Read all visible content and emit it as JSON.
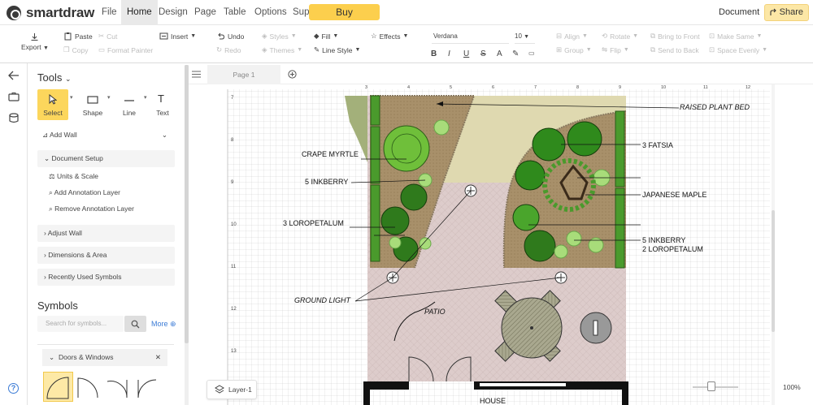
{
  "app": {
    "brand": "smartdraw",
    "document_label": "Document",
    "share_label": "Share",
    "buy_label": "Buy"
  },
  "menu": [
    "File",
    "Home",
    "Design",
    "Page",
    "Table",
    "Options",
    "Support"
  ],
  "menu_active": "Home",
  "ribbon": {
    "export": "Export",
    "paste": "Paste",
    "cut": "Cut",
    "copy": "Copy",
    "format_painter": "Format Painter",
    "insert": "Insert",
    "undo": "Undo",
    "redo": "Redo",
    "styles": "Styles",
    "themes": "Themes",
    "fill": "Fill",
    "line_style": "Line Style",
    "effects": "Effects",
    "font": "Verdana",
    "font_size": "10",
    "bold": "B",
    "italic": "I",
    "underline": "U",
    "strike": "S",
    "align": "Align",
    "group": "Group",
    "rotate": "Rotate",
    "flip": "Flip",
    "bring_to_front": "Bring to Front",
    "send_to_back": "Send to Back",
    "make_same": "Make Same",
    "space_evenly": "Space Evenly"
  },
  "panel": {
    "tools_title": "Tools",
    "tools": [
      "Select",
      "Shape",
      "Line",
      "Text"
    ],
    "add_wall": "Add Wall",
    "document_setup": "Document Setup",
    "setup_items": [
      "Units & Scale",
      "Add Annotation Layer",
      "Remove Annotation Layer"
    ],
    "adjust_wall": "Adjust Wall",
    "dimensions_area": "Dimensions & Area",
    "recently_used": "Recently Used Symbols",
    "symbols_title": "Symbols",
    "search_placeholder": "Search for symbols...",
    "more": "More",
    "doors_windows": "Doors & Windows"
  },
  "page": {
    "tab": "Page 1",
    "layer": "Layer-1",
    "zoom": "100%"
  },
  "ruler": {
    "top": [
      "3",
      "4",
      "5",
      "6",
      "7",
      "8",
      "9",
      "10",
      "11",
      "12"
    ],
    "left": [
      "7",
      "8",
      "9",
      "10",
      "11",
      "12",
      "13"
    ]
  },
  "plan": {
    "raised_plant_bed": "RAISED PLANT BED",
    "crape_myrtle": "CRAPE MYRTLE",
    "inkberry_left": "5 INKBERRY",
    "loropetalum_left": "3 LOROPETALUM",
    "fatsia": "3 FATSIA",
    "japanese_maple": "JAPANESE MAPLE",
    "inkberry_right": "5 INKBERRY",
    "loropetalum_right": "2 LOROPETALUM",
    "ground_light": "GROUND LIGHT",
    "patio": "PATIO",
    "house": "HOUSE"
  },
  "colors": {
    "accent": "#fcd65c",
    "bed_green": "#4a9a2c",
    "soil": "#b49a6c",
    "paving": "#dcc9c6"
  }
}
